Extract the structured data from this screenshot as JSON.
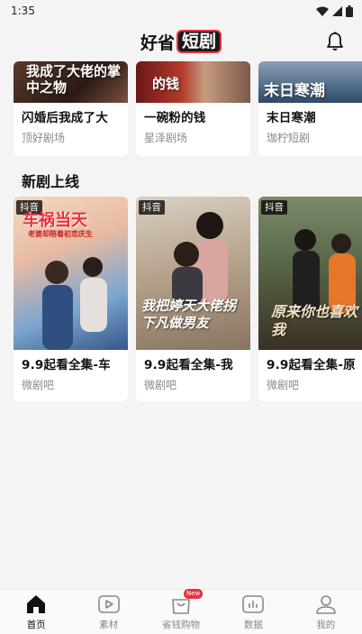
{
  "status": {
    "time": "1:35"
  },
  "header": {
    "brand_left": "好省",
    "brand_right": "短剧"
  },
  "top_row": [
    {
      "title": "闪婚后我成了大",
      "studio": "顶好剧场",
      "poster_text": "我成了大佬的掌中之物"
    },
    {
      "title": "一碗粉的钱",
      "studio": "星泽剧场",
      "poster_text": "的钱"
    },
    {
      "title": "末日寒潮",
      "studio": "珈柠短剧",
      "poster_text": "末日寒潮"
    }
  ],
  "section": {
    "title": "新剧上线"
  },
  "new_row": [
    {
      "tag": "抖音",
      "title": "9.9起看全集-车",
      "studio": "微剧吧",
      "poster_text": "车祸当天",
      "poster_sub": "老婆却陪着初恋庆生"
    },
    {
      "tag": "抖音",
      "title": "9.9起看全集-我",
      "studio": "微剧吧",
      "poster_text": "我把婷天大佬拐下凡做男友"
    },
    {
      "tag": "抖音",
      "title": "9.9起看全集-原",
      "studio": "微剧吧",
      "poster_text": "原来你也喜欢我"
    }
  ],
  "tabs": [
    {
      "label": "首页",
      "icon": "home-icon",
      "active": true
    },
    {
      "label": "素材",
      "icon": "video-icon",
      "active": false
    },
    {
      "label": "省钱购物",
      "icon": "shopping-bag-icon",
      "active": false,
      "badge": "New"
    },
    {
      "label": "数据",
      "icon": "chart-icon",
      "active": false
    },
    {
      "label": "我的",
      "icon": "user-icon",
      "active": false
    }
  ]
}
